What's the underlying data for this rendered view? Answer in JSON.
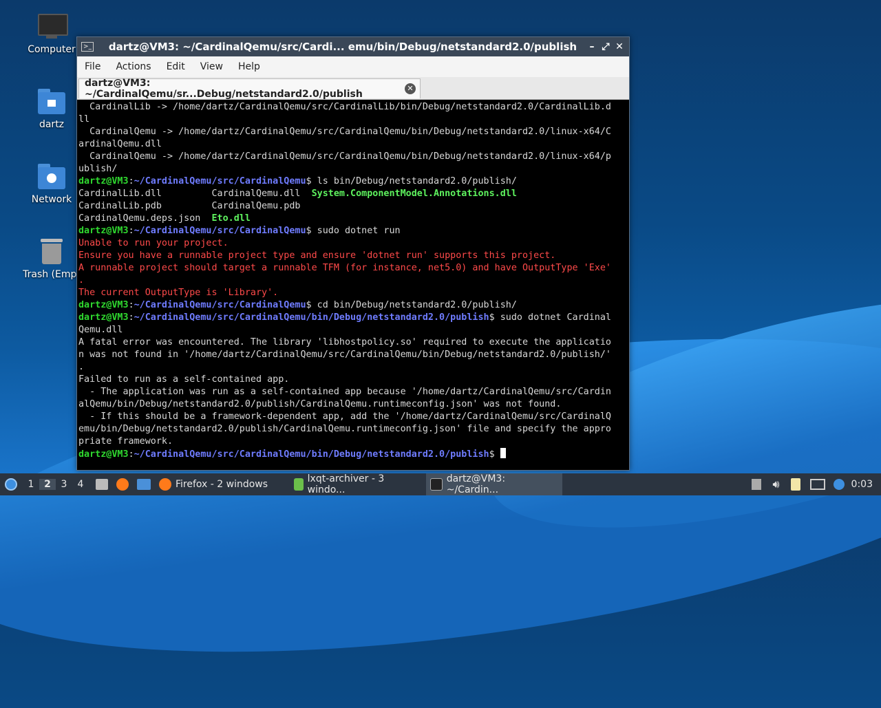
{
  "desktop": {
    "icons": [
      {
        "label": "Computer",
        "icon": "computer-icon"
      },
      {
        "label": "dartz",
        "icon": "home-folder-icon"
      },
      {
        "label": "Network",
        "icon": "network-folder-icon"
      },
      {
        "label": "Trash (Empt",
        "icon": "trash-icon"
      }
    ]
  },
  "window": {
    "title": "dartz@VM3: ~/CardinalQemu/src/Cardi... emu/bin/Debug/netstandard2.0/publish",
    "menu": [
      "File",
      "Actions",
      "Edit",
      "View",
      "Help"
    ],
    "tab_label": "dartz@VM3: ~/CardinalQemu/sr...Debug/netstandard2.0/publish"
  },
  "terminal": {
    "prompt_user": "dartz@VM3",
    "lines": [
      "  CardinalLib -> /home/dartz/CardinalQemu/src/CardinalLib/bin/Debug/netstandard2.0/CardinalLib.d",
      "ll",
      "  CardinalQemu -> /home/dartz/CardinalQemu/src/CardinalQemu/bin/Debug/netstandard2.0/linux-x64/C",
      "ardinalQemu.dll",
      "  CardinalQemu -> /home/dartz/CardinalQemu/src/CardinalQemu/bin/Debug/netstandard2.0/linux-x64/p",
      "ublish/",
      {
        "path": "~/CardinalQemu/src/CardinalQemu",
        "cmd": " ls bin/Debug/netstandard2.0/publish/"
      },
      {
        "cols": [
          "CardinalLib.dll         ",
          "CardinalQemu.dll  "
        ],
        "bold": "System.ComponentModel.Annotations.dll"
      },
      {
        "cols": [
          "CardinalLib.pdb         ",
          "CardinalQemu.pdb"
        ],
        "bold": ""
      },
      {
        "cols": [
          "CardinalQemu.deps.json  "
        ],
        "bold": "Eto.dll"
      },
      {
        "path": "~/CardinalQemu/src/CardinalQemu",
        "cmd": " sudo dotnet run"
      },
      {
        "err": "Unable to run your project."
      },
      {
        "err": "Ensure you have a runnable project type and ensure 'dotnet run' supports this project."
      },
      {
        "err": "A runnable project should target a runnable TFM (for instance, net5.0) and have OutputType 'Exe'"
      },
      {
        "err": "."
      },
      {
        "err": "The current OutputType is 'Library'."
      },
      {
        "path": "~/CardinalQemu/src/CardinalQemu",
        "cmd": " cd bin/Debug/netstandard2.0/publish/"
      },
      {
        "path": "~/CardinalQemu/src/CardinalQemu/bin/Debug/netstandard2.0/publish",
        "cmd": " sudo dotnet Cardinal"
      },
      "Qemu.dll",
      "A fatal error was encountered. The library 'libhostpolicy.so' required to execute the applicatio",
      "n was not found in '/home/dartz/CardinalQemu/src/CardinalQemu/bin/Debug/netstandard2.0/publish/'",
      ".",
      "Failed to run as a self-contained app.",
      "  - The application was run as a self-contained app because '/home/dartz/CardinalQemu/src/Cardin",
      "alQemu/bin/Debug/netstandard2.0/publish/CardinalQemu.runtimeconfig.json' was not found.",
      "  - If this should be a framework-dependent app, add the '/home/dartz/CardinalQemu/src/CardinalQ",
      "emu/bin/Debug/netstandard2.0/publish/CardinalQemu.runtimeconfig.json' file and specify the appro",
      "priate framework.",
      {
        "path": "~/CardinalQemu/src/CardinalQemu/bin/Debug/netstandard2.0/publish",
        "cmd": " ",
        "cursor": true
      }
    ]
  },
  "taskbar": {
    "workspaces": [
      "1",
      "2",
      "3",
      "4"
    ],
    "active_workspace": "2",
    "tasks": [
      {
        "label": "Firefox - 2 windows",
        "icon": "firefox-icon"
      },
      {
        "label": "lxqt-archiver - 3 windo...",
        "icon": "archiver-icon"
      },
      {
        "label": "dartz@VM3: ~/Cardin...",
        "icon": "terminal-icon"
      }
    ],
    "clock": "0:03"
  },
  "colors": {
    "prompt_green": "#2fd82f",
    "path_blue": "#6f7cff",
    "error_red": "#ff4a4a"
  }
}
